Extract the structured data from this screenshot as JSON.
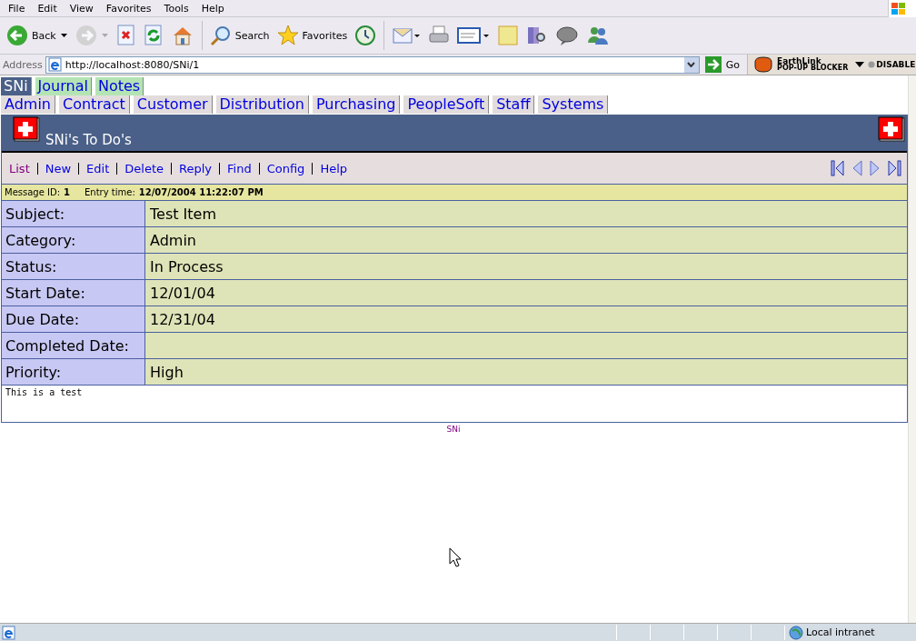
{
  "menu_bar": [
    "File",
    "Edit",
    "View",
    "Favorites",
    "Tools",
    "Help"
  ],
  "toolbar": [
    {
      "kind": "back",
      "label": "Back",
      "disabled": false
    },
    {
      "kind": "forward",
      "disabled": true
    },
    {
      "kind": "stop",
      "disabled": false
    },
    {
      "kind": "refresh",
      "disabled": false
    },
    {
      "kind": "home",
      "disabled": false
    },
    {
      "kind": "search",
      "label": "Search",
      "disabled": false
    },
    {
      "kind": "favorites",
      "label": "Favorites",
      "disabled": false
    },
    {
      "kind": "history",
      "disabled": false
    },
    {
      "kind": "mail",
      "disabled": false
    },
    {
      "kind": "print",
      "disabled": false
    },
    {
      "kind": "edit",
      "disabled": false
    },
    {
      "kind": "note",
      "disabled": false
    },
    {
      "kind": "research",
      "disabled": false
    },
    {
      "kind": "messenger",
      "disabled": false
    },
    {
      "kind": "people",
      "disabled": false
    }
  ],
  "address_bar": {
    "label": "Address",
    "value": "http://localhost:8080/SNi/1",
    "go": "Go",
    "blocker_top": "EarthLink",
    "blocker_bottom": "POP-UP BLOCKER",
    "blocker_state": "DISABLE"
  },
  "app_tabs": [
    {
      "label": "SNi",
      "selected": true
    },
    {
      "label": "Journal",
      "selected": false
    },
    {
      "label": "Notes",
      "selected": false
    }
  ],
  "section_tabs": [
    {
      "label": "Admin"
    },
    {
      "label": "Contract"
    },
    {
      "label": "Customer"
    },
    {
      "label": "Distribution"
    },
    {
      "label": "Purchasing"
    },
    {
      "label": "PeopleSoft"
    },
    {
      "label": "Staff"
    },
    {
      "label": "Systems"
    }
  ],
  "header": {
    "title": "SNi's To Do's"
  },
  "actions": [
    {
      "label": "List",
      "visited": true
    },
    {
      "label": "New",
      "visited": false
    },
    {
      "label": "Edit",
      "visited": false
    },
    {
      "label": "Delete",
      "visited": false
    },
    {
      "label": "Reply",
      "visited": false
    },
    {
      "label": "Find",
      "visited": false
    },
    {
      "label": "Config",
      "visited": false
    },
    {
      "label": "Help",
      "visited": false
    }
  ],
  "message": {
    "id_label": "Message ID:",
    "id": "1",
    "time_label": "Entry time:",
    "time": "12/07/2004 11:22:07 PM"
  },
  "fields": [
    {
      "label": "Subject:",
      "value": "Test Item"
    },
    {
      "label": "Category:",
      "value": "Admin"
    },
    {
      "label": "Status:",
      "value": "In Process"
    },
    {
      "label": "Start Date:",
      "value": "12/01/04"
    },
    {
      "label": "Due Date:",
      "value": "12/31/04"
    },
    {
      "label": "Completed Date:"
    },
    {
      "label": "Priority:",
      "value": "High"
    }
  ],
  "body": "This is a test",
  "footer": "SNi",
  "status_bar": {
    "zone": "Local intranet"
  }
}
